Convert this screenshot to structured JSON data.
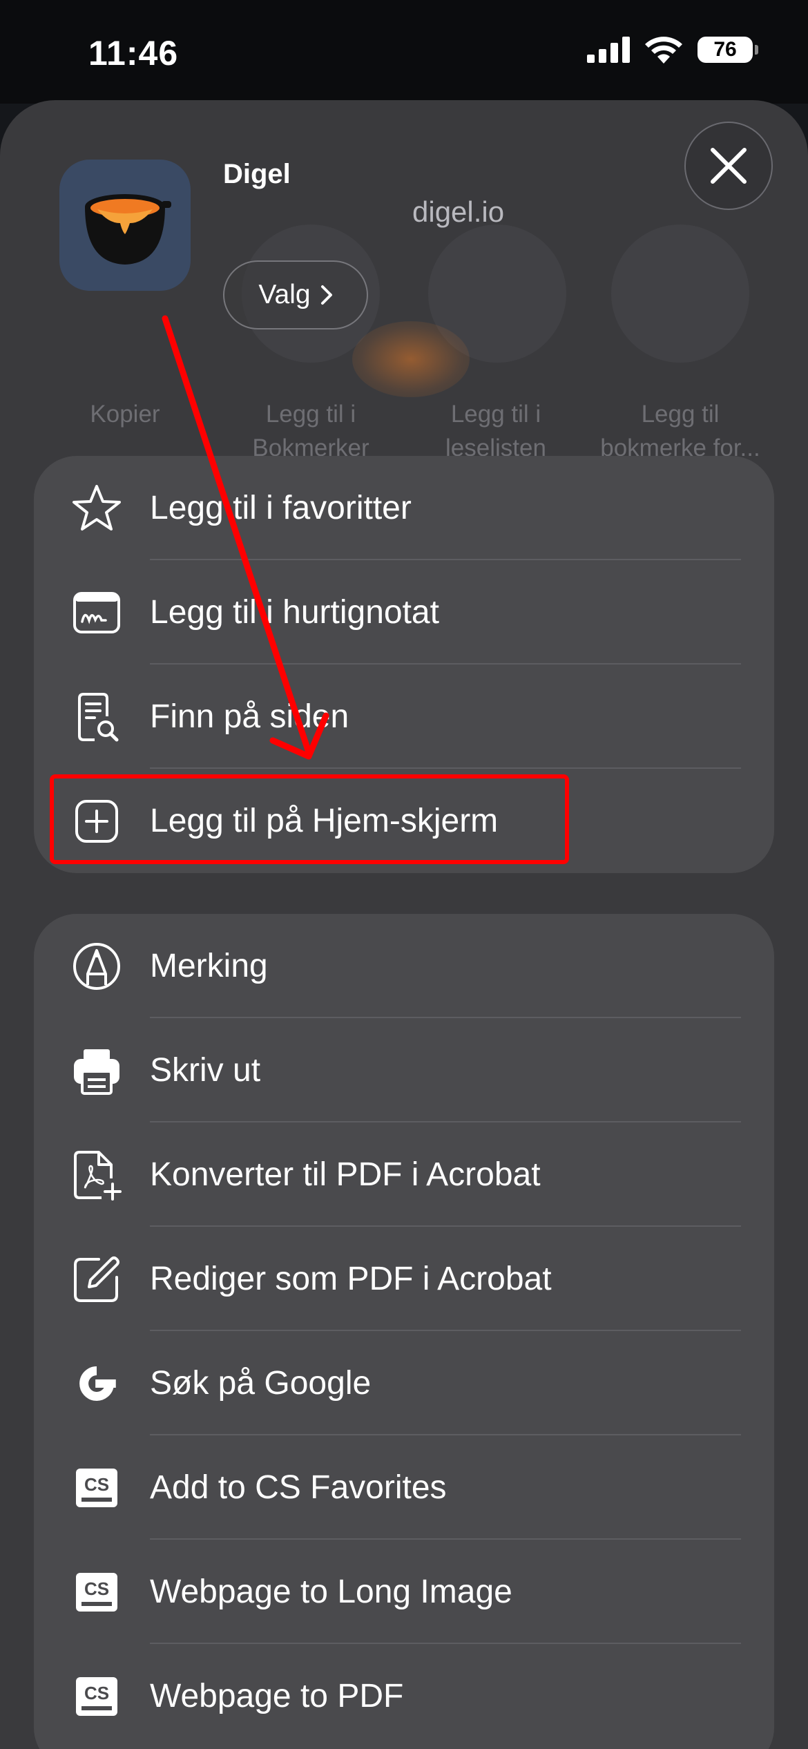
{
  "status_bar": {
    "time": "11:46",
    "battery": "76"
  },
  "share_sheet": {
    "app": {
      "name": "Digel",
      "url": "digel.io",
      "options_label": "Valg"
    },
    "ghost_actions": [
      {
        "label": "Kopier"
      },
      {
        "label": "Legg til i Bokmerker"
      },
      {
        "label": "Legg til i leselisten"
      },
      {
        "label": "Legg til bokmerke for..."
      }
    ],
    "group1": [
      {
        "label": "Legg til i favoritter",
        "icon": "star-icon"
      },
      {
        "label": "Legg til i hurtignotat",
        "icon": "quick-note-icon"
      },
      {
        "label": "Finn på siden",
        "icon": "find-on-page-icon"
      },
      {
        "label": "Legg til på Hjem-skjerm",
        "icon": "add-square-icon"
      }
    ],
    "group2": [
      {
        "label": "Merking",
        "icon": "markup-icon"
      },
      {
        "label": "Skriv ut",
        "icon": "printer-icon"
      },
      {
        "label": "Konverter til PDF i Acrobat",
        "icon": "acrobat-convert-icon"
      },
      {
        "label": "Rediger som PDF i Acrobat",
        "icon": "acrobat-edit-icon"
      },
      {
        "label": "Søk på Google",
        "icon": "google-icon"
      },
      {
        "label": "Add to CS Favorites",
        "icon": "cs-icon"
      },
      {
        "label": "Webpage to Long Image",
        "icon": "cs-icon"
      },
      {
        "label": "Webpage to PDF",
        "icon": "cs-icon"
      }
    ]
  },
  "annotation": {
    "color": "#ff0000"
  }
}
